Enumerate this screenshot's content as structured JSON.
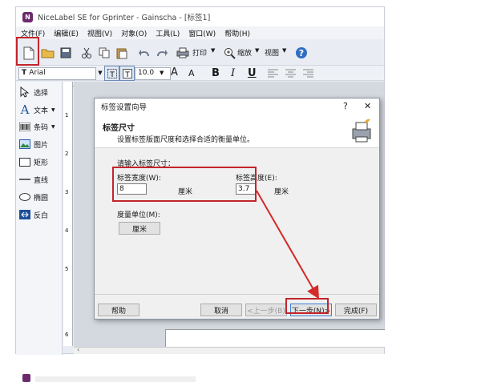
{
  "window": {
    "title": "NiceLabel SE for Gprinter - Gainscha - [标签1]",
    "logo": "N"
  },
  "menu": [
    "文件(F)",
    "编辑(E)",
    "视图(V)",
    "对象(O)",
    "工具(L)",
    "窗口(W)",
    "帮助(H)"
  ],
  "toolbar": {
    "print_label": "打印",
    "zoom_label": "缩放",
    "view_label": "视图"
  },
  "format_bar": {
    "font": "Arial",
    "size": "10.0",
    "bold": "B",
    "italic": "I",
    "underline": "U",
    "grow": "A",
    "shrink": "A"
  },
  "sidebar": [
    {
      "label": "选择",
      "icon": "pointer-icon"
    },
    {
      "label": "文本",
      "icon": "text-tool-icon"
    },
    {
      "label": "条码",
      "icon": "barcode-icon"
    },
    {
      "label": "图片",
      "icon": "picture-icon"
    },
    {
      "label": "矩形",
      "icon": "rectangle-icon"
    },
    {
      "label": "直线",
      "icon": "line-icon"
    },
    {
      "label": "椭圆",
      "icon": "ellipse-icon"
    },
    {
      "label": "反白",
      "icon": "inverse-icon"
    }
  ],
  "ruler_numbers": [
    "1",
    "2",
    "3",
    "4",
    "5",
    "6"
  ],
  "dialog": {
    "title": "标签设置向导",
    "help_char": "?",
    "close_char": "✕",
    "header_title": "标签尺寸",
    "header_desc": "设置标签版面尺度和选择合适的衡量单位。",
    "prompt": "请输入标签尺寸：",
    "width_label": "标签宽度(W):",
    "width_value": "8",
    "width_unit": "厘米",
    "height_label": "标签高度(E):",
    "height_value": "3.7",
    "height_unit": "厘米",
    "unit_label": "度量单位(M):",
    "unit_button": "厘米",
    "buttons": {
      "help": "帮助",
      "cancel": "取消",
      "back": "<上一步(B)",
      "next": "下一步(N)>",
      "finish": "完成(F)"
    }
  },
  "colors": {
    "highlight": "#c4232b",
    "brand": "#6b2a6e"
  }
}
